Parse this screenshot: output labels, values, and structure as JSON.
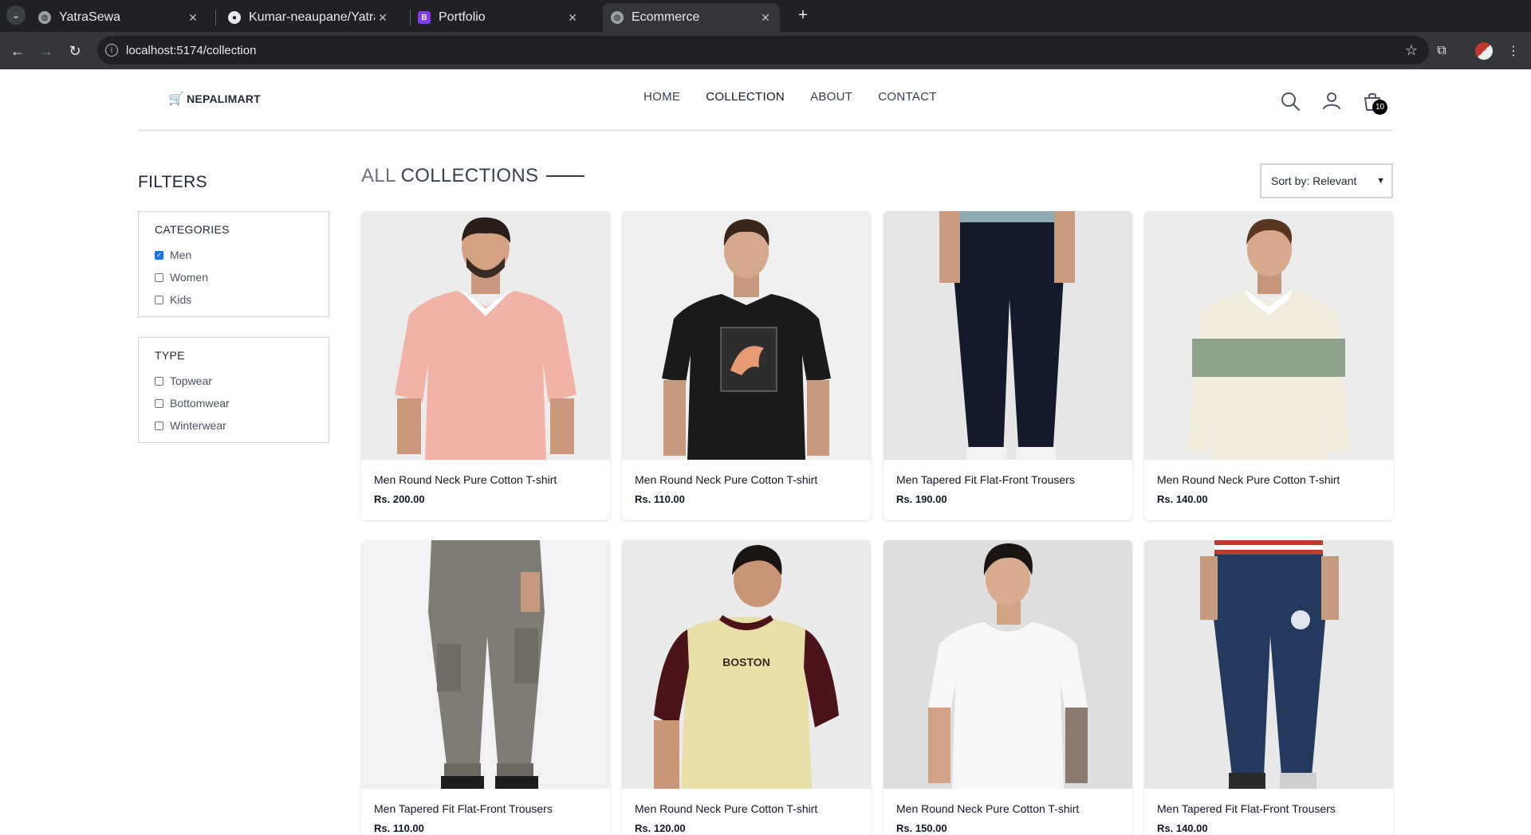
{
  "browser": {
    "tabs": [
      {
        "title": "YatraSewa",
        "icon": "globe-icon"
      },
      {
        "title": "Kumar-neaupane/YatraS",
        "icon": "github-icon"
      },
      {
        "title": "Portfolio",
        "icon": "bootstrap-icon"
      },
      {
        "title": "Ecommerce",
        "icon": "globe-icon",
        "active": true
      }
    ],
    "url": "localhost:5174/collection"
  },
  "header": {
    "logo": "NEPALIMART",
    "nav": [
      "HOME",
      "COLLECTION",
      "ABOUT",
      "CONTACT"
    ],
    "active_nav": "COLLECTION",
    "cart_count": "10"
  },
  "filters": {
    "title": "FILTERS",
    "categories": {
      "title": "CATEGORIES",
      "options": [
        {
          "label": "Men",
          "checked": true
        },
        {
          "label": "Women",
          "checked": false
        },
        {
          "label": "Kids",
          "checked": false
        }
      ]
    },
    "type": {
      "title": "TYPE",
      "options": [
        {
          "label": "Topwear",
          "checked": false
        },
        {
          "label": "Bottomwear",
          "checked": false
        },
        {
          "label": "Winterwear",
          "checked": false
        }
      ]
    }
  },
  "collection": {
    "title_light": "ALL",
    "title_strong": "COLLECTIONS",
    "sort": "Sort by: Relevant"
  },
  "products": [
    {
      "name": "Men Round Neck Pure Cotton T-shirt",
      "price": "Rs. 200.00",
      "kind": "polo-pink"
    },
    {
      "name": "Men Round Neck Pure Cotton T-shirt",
      "price": "Rs. 110.00",
      "kind": "tee-black"
    },
    {
      "name": "Men Tapered Fit Flat-Front Trousers",
      "price": "Rs. 190.00",
      "kind": "trousers-navy"
    },
    {
      "name": "Men Round Neck Pure Cotton T-shirt",
      "price": "Rs. 140.00",
      "kind": "polo-stripe"
    },
    {
      "name": "Men Tapered Fit Flat-Front Trousers",
      "price": "Rs. 110.00",
      "kind": "cargo-grey"
    },
    {
      "name": "Men Round Neck Pure Cotton T-shirt",
      "price": "Rs. 120.00",
      "kind": "raglan"
    },
    {
      "name": "Men Round Neck Pure Cotton T-shirt",
      "price": "Rs. 150.00",
      "kind": "tee-white"
    },
    {
      "name": "Men Tapered Fit Flat-Front Trousers",
      "price": "Rs. 140.00",
      "kind": "jogger-navy"
    }
  ],
  "product_image_text": {
    "boston": "BOSTON"
  }
}
